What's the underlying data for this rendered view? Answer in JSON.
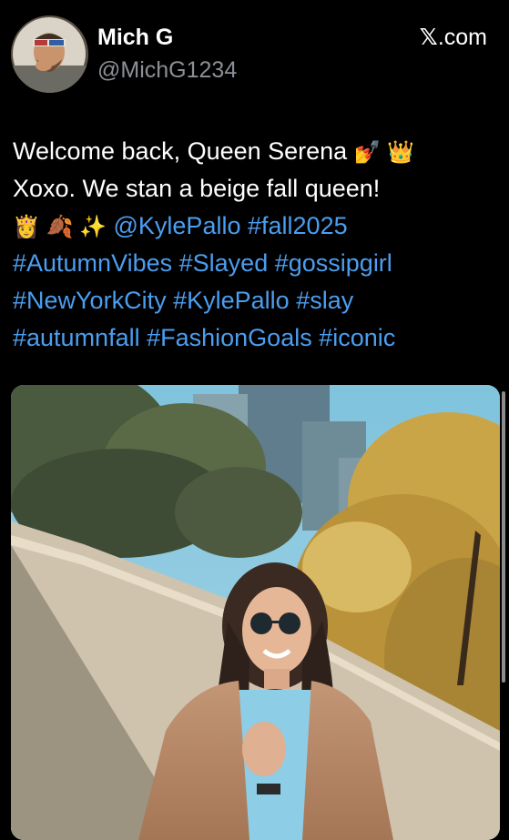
{
  "author": {
    "display_name": "Mich G",
    "handle": "@MichG1234"
  },
  "source": {
    "label": ".com",
    "icon": "x-logo-icon"
  },
  "tweet": {
    "line1": "Welcome back, Queen Serena",
    "line1_emoji": "💅 👑",
    "line2": " Xoxo. We stan a beige fall queen!",
    "line3_emoji": "👸 🍂 ✨",
    "mention": "@KylePallo",
    "tags_line3": [
      "#fall2025"
    ],
    "tags_line4": [
      "#AutumnVibes",
      "#Slayed",
      "#gossipgirl"
    ],
    "tags_line5": [
      "#NewYorkCity",
      "#KylePallo",
      "#slay"
    ],
    "tags_line6": [
      "#autumnfall",
      "#FashionGoals",
      "#iconic"
    ]
  },
  "media": {
    "type": "photo"
  },
  "colors": {
    "background": "#000000",
    "text": "#ffffff",
    "secondary": "#8b9096",
    "link": "#4b9ef0"
  }
}
